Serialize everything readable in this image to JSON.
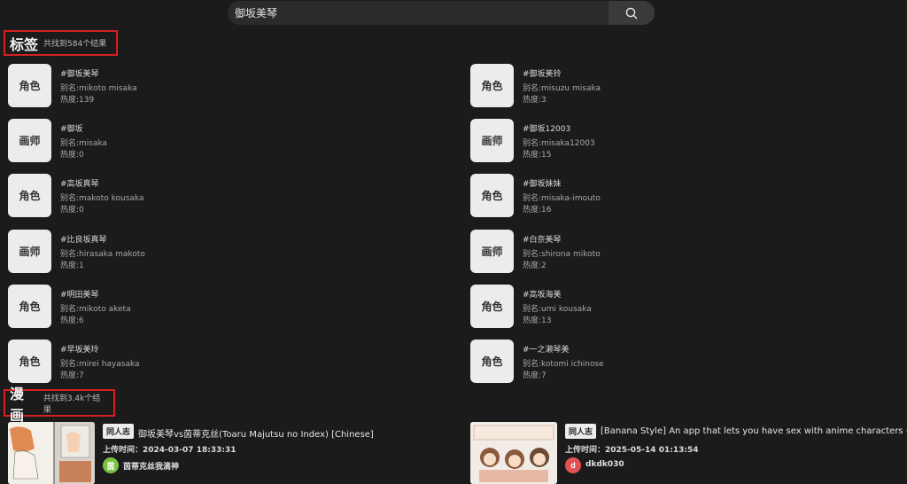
{
  "search": {
    "query": "御坂美琴"
  },
  "tags_section": {
    "title": "标签",
    "count_text": "共找到584个结果"
  },
  "tags": [
    {
      "type": "角色",
      "name": "#御坂美琴",
      "alias": "别名:mikoto misaka",
      "heat": "热度:139"
    },
    {
      "type": "画师",
      "name": "#御坂",
      "alias": "别名:misaka",
      "heat": "热度:0"
    },
    {
      "type": "角色",
      "name": "#高坂真琴",
      "alias": "别名:makoto kousaka",
      "heat": "热度:0"
    },
    {
      "type": "画师",
      "name": "#比良坂真琴",
      "alias": "别名:hirasaka makoto",
      "heat": "热度:1"
    },
    {
      "type": "角色",
      "name": "#明田美琴",
      "alias": "别名:mikoto aketa",
      "heat": "热度:6"
    },
    {
      "type": "角色",
      "name": "#早坂美玲",
      "alias": "别名:mirei hayasaka",
      "heat": "热度:7"
    },
    {
      "type": "角色",
      "name": "#御坂美铃",
      "alias": "别名:misuzu misaka",
      "heat": "热度:3"
    },
    {
      "type": "画师",
      "name": "#御坂12003",
      "alias": "别名:misaka12003",
      "heat": "热度:15"
    },
    {
      "type": "角色",
      "name": "#御坂妹妹",
      "alias": "别名:misaka-imouto",
      "heat": "热度:16"
    },
    {
      "type": "画师",
      "name": "#白奈美琴",
      "alias": "别名:shirona mikoto",
      "heat": "热度:2"
    },
    {
      "type": "角色",
      "name": "#高坂海美",
      "alias": "别名:umi kousaka",
      "heat": "热度:13"
    },
    {
      "type": "角色",
      "name": "#一之濑琴美",
      "alias": "别名:kotomi ichinose",
      "heat": "热度:7"
    }
  ],
  "comics_section": {
    "title": "漫画",
    "count_text": "共找到3.4k个结果"
  },
  "comics": [
    {
      "type": "同人志",
      "title": "御坂美琴vs茵蒂克丝(Toaru Majutsu no Index) [Chinese]",
      "upload": "上传时间：2024-03-07 18:33:31",
      "avatar_letter": "茵",
      "avatar_color": "#7cc242",
      "author": "茵蒂克丝我滴神"
    },
    {
      "type": "同人志",
      "title": "[Banana Style] An app that lets you have sex with anime characters (Misaka",
      "upload": "上传时间：2025-05-14 01:13:54",
      "avatar_letter": "d",
      "avatar_color": "#e25252",
      "author": "dkdk030"
    }
  ]
}
